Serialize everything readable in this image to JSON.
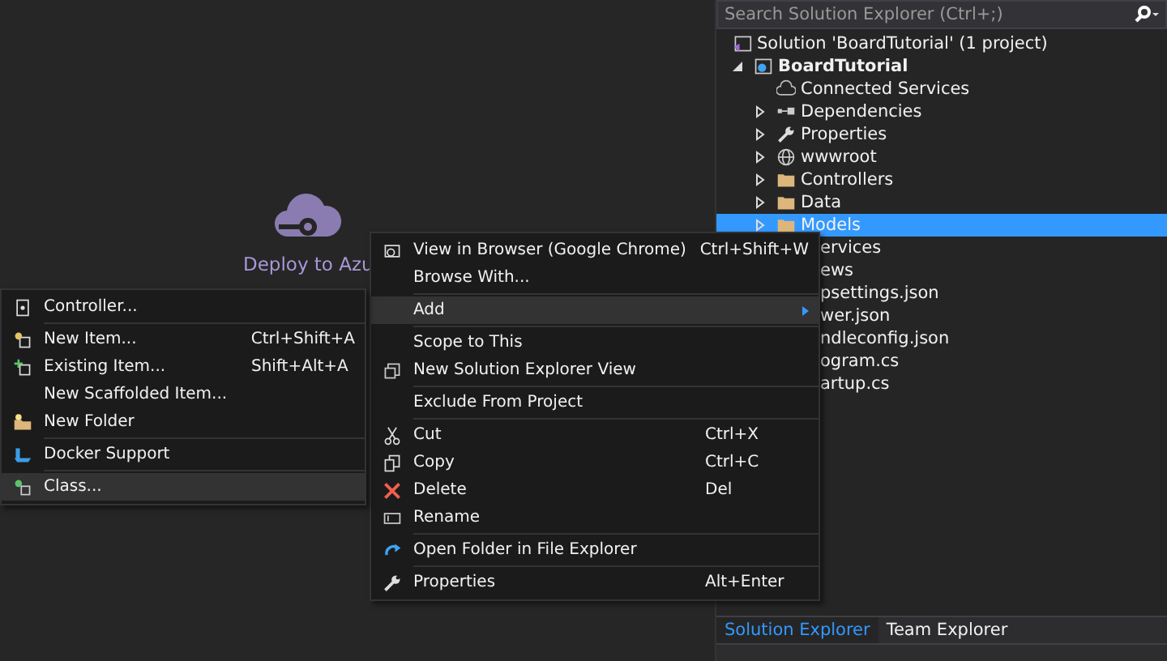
{
  "deploy": {
    "label": "Deploy to Azu"
  },
  "solution_explorer": {
    "search": {
      "placeholder": "Search Solution Explorer (Ctrl+;)"
    },
    "tree": [
      {
        "label": "Solution 'BoardTutorial' (1 project)",
        "selected": false,
        "children": [
          {
            "label": "BoardTutorial",
            "expanded": true,
            "selected": false,
            "children": [
              {
                "label": "Connected Services",
                "selected": false
              },
              {
                "label": "Dependencies",
                "expanded": false,
                "selected": false
              },
              {
                "label": "Properties",
                "expanded": false,
                "selected": false
              },
              {
                "label": "wwwroot",
                "expanded": false,
                "selected": false
              },
              {
                "label": "Controllers",
                "expanded": false,
                "selected": false
              },
              {
                "label": "Data",
                "expanded": false,
                "selected": false
              },
              {
                "label": "Models",
                "expanded": false,
                "selected": true
              },
              {
                "label": "ervices",
                "selected": false,
                "kind": "partial"
              },
              {
                "label": "ews",
                "selected": false,
                "kind": "partial"
              },
              {
                "label": "psettings.json",
                "selected": false,
                "kind": "partial"
              },
              {
                "label": "wer.json",
                "selected": false,
                "kind": "partial"
              },
              {
                "label": "ndleconfig.json",
                "selected": false,
                "kind": "partial"
              },
              {
                "label": "ogram.cs",
                "selected": false,
                "kind": "partial"
              },
              {
                "label": "artup.cs",
                "selected": false,
                "kind": "partial"
              }
            ]
          }
        ]
      }
    ],
    "tabs": [
      {
        "label": "Solution Explorer",
        "selected": true
      },
      {
        "label": "Team Explorer",
        "selected": false
      }
    ]
  },
  "context_menu": {
    "items": [
      {
        "label": "View in Browser (Google Chrome)",
        "shortcut": "Ctrl+Shift+W",
        "selected": false
      },
      {
        "label": "Browse With...",
        "selected": false
      },
      {
        "label": "Add",
        "submenu": true,
        "selected": true,
        "separator_before": true
      },
      {
        "label": "Scope to This",
        "selected": false,
        "separator_before": true
      },
      {
        "label": "New Solution Explorer View",
        "selected": false
      },
      {
        "label": "Exclude From Project",
        "selected": false,
        "separator_before": true
      },
      {
        "label": "Cut",
        "shortcut": "Ctrl+X",
        "selected": false,
        "separator_before": true
      },
      {
        "label": "Copy",
        "shortcut": "Ctrl+C",
        "selected": false
      },
      {
        "label": "Delete",
        "shortcut": "Del",
        "selected": false
      },
      {
        "label": "Rename",
        "selected": false
      },
      {
        "label": "Open Folder in File Explorer",
        "selected": false,
        "separator_before": true
      },
      {
        "label": "Properties",
        "shortcut": "Alt+Enter",
        "selected": false,
        "separator_before": true
      }
    ]
  },
  "add_submenu": {
    "items": [
      {
        "label": "Controller...",
        "selected": false
      },
      {
        "label": "New Item...",
        "shortcut": "Ctrl+Shift+A",
        "selected": false,
        "separator_before": true
      },
      {
        "label": "Existing Item...",
        "shortcut": "Shift+Alt+A",
        "selected": false
      },
      {
        "label": "New Scaffolded Item...",
        "selected": false
      },
      {
        "label": "New Folder",
        "selected": false
      },
      {
        "label": "Docker Support",
        "selected": false,
        "separator_before": true
      },
      {
        "label": "Class...",
        "selected": true,
        "separator_before": true
      }
    ]
  }
}
